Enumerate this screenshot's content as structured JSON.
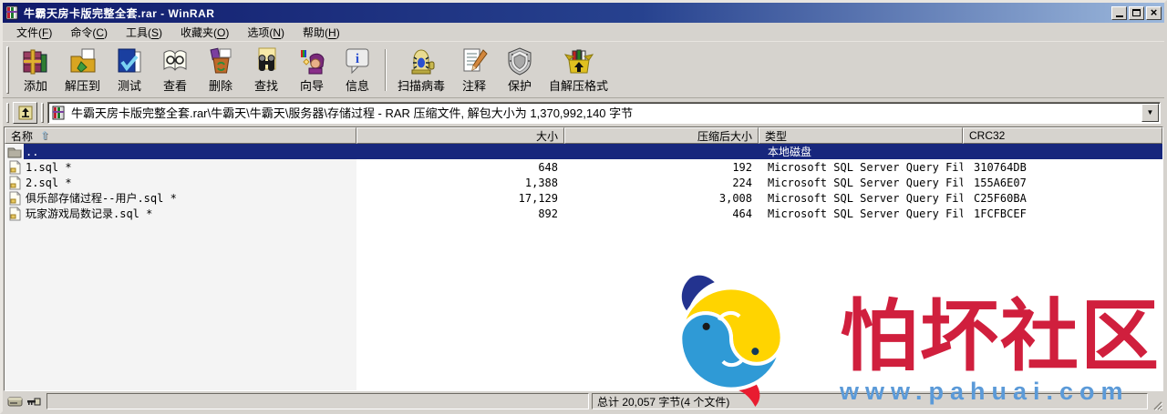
{
  "window": {
    "title": "牛霸天房卡版完整全套.rar - WinRAR"
  },
  "colors": {
    "titlebar_left": "#101a6b",
    "titlebar_right": "#9cb8dc",
    "selection": "#17277d",
    "chrome": "#d6d3ce",
    "watermark_red": "#d01f3d",
    "watermark_blue": "#5b9ad8",
    "fish_yellow": "#ffd400",
    "fish_blue": "#2f9ad6"
  },
  "menu": {
    "items": [
      {
        "pre": "文件(",
        "key": "F",
        "post": ")"
      },
      {
        "pre": "命令(",
        "key": "C",
        "post": ")"
      },
      {
        "pre": "工具(",
        "key": "S",
        "post": ")"
      },
      {
        "pre": "收藏夹(",
        "key": "O",
        "post": ")"
      },
      {
        "pre": "选项(",
        "key": "N",
        "post": ")"
      },
      {
        "pre": "帮助(",
        "key": "H",
        "post": ")"
      }
    ]
  },
  "toolbar": {
    "buttons": [
      {
        "label": "添加",
        "icon": "add-icon"
      },
      {
        "label": "解压到",
        "icon": "extract-to-icon"
      },
      {
        "label": "测试",
        "icon": "test-icon"
      },
      {
        "label": "查看",
        "icon": "view-icon"
      },
      {
        "label": "删除",
        "icon": "delete-icon"
      },
      {
        "label": "查找",
        "icon": "find-icon"
      },
      {
        "label": "向导",
        "icon": "wizard-icon"
      },
      {
        "label": "信息",
        "icon": "info-icon"
      },
      {
        "label": "扫描病毒",
        "icon": "scan-virus-icon"
      },
      {
        "label": "注释",
        "icon": "comment-icon"
      },
      {
        "label": "保护",
        "icon": "protect-icon"
      },
      {
        "label": "自解压格式",
        "icon": "sfx-icon"
      }
    ]
  },
  "addressbar": {
    "path": "牛霸天房卡版完整全套.rar\\牛霸天\\牛霸天\\服务器\\存储过程 - RAR 压缩文件, 解包大小为 1,370,992,140 字节"
  },
  "list": {
    "columns": [
      {
        "label": "名称"
      },
      {
        "label": "大小"
      },
      {
        "label": "压缩后大小"
      },
      {
        "label": "类型"
      },
      {
        "label": "CRC32"
      }
    ],
    "parent": {
      "name": "..",
      "type": "本地磁盘"
    },
    "rows": [
      {
        "name": "1.sql *",
        "size": "648",
        "packed": "192",
        "type": "Microsoft SQL Server Query File",
        "crc": "310764DB"
      },
      {
        "name": "2.sql *",
        "size": "1,388",
        "packed": "224",
        "type": "Microsoft SQL Server Query File",
        "crc": "155A6E07"
      },
      {
        "name": "俱乐部存储过程--用户.sql *",
        "size": "17,129",
        "packed": "3,008",
        "type": "Microsoft SQL Server Query File",
        "crc": "C25F60BA"
      },
      {
        "name": "玩家游戏局数记录.sql *",
        "size": "892",
        "packed": "464",
        "type": "Microsoft SQL Server Query File",
        "crc": "1FCFBCEF"
      }
    ]
  },
  "statusbar": {
    "total": "总计 20,057 字节(4 个文件)"
  },
  "watermark": {
    "title": "怕坏社区",
    "url": "www.pahuai.com"
  }
}
